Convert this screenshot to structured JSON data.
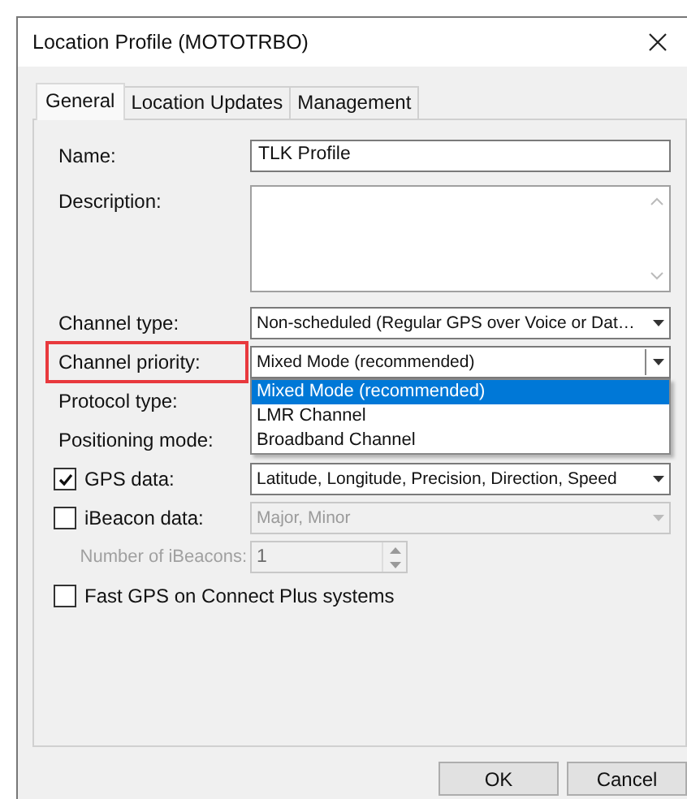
{
  "window": {
    "title": "Location Profile (MOTOTRBO)"
  },
  "tabs": [
    {
      "label": "General",
      "selected": true
    },
    {
      "label": "Location Updates",
      "selected": false
    },
    {
      "label": "Management",
      "selected": false
    }
  ],
  "fields": [
    {
      "kind": "text",
      "label": "Name:",
      "value": "TLK Profile",
      "highlighted": false
    },
    {
      "kind": "textarea",
      "label": "Description:",
      "highlighted": false
    },
    {
      "kind": "select",
      "label": "Channel type:",
      "value": "Non-scheduled (Regular GPS over Voice or Dat…",
      "highlighted": false,
      "expanded": false
    },
    {
      "kind": "select",
      "label": "Channel priority:",
      "value": "Mixed Mode (recommended)",
      "highlighted": true,
      "expanded": true,
      "options": [
        {
          "label": "Mixed Mode (recommended)",
          "selected": true
        },
        {
          "label": "LMR Channel",
          "selected": false
        },
        {
          "label": "Broadband Channel",
          "selected": false
        }
      ]
    },
    {
      "kind": "label",
      "label": "Protocol type:",
      "highlighted": false
    },
    {
      "kind": "label",
      "label": "Positioning mode:",
      "highlighted": false
    },
    {
      "kind": "checkbox-select",
      "label": "GPS data:",
      "checked": true,
      "disabled": false,
      "value": "Latitude, Longitude, Precision, Direction, Speed",
      "highlighted": false
    },
    {
      "kind": "checkbox-select",
      "label": "iBeacon data:",
      "checked": false,
      "disabled": true,
      "value": "Major, Minor",
      "highlighted": false
    },
    {
      "kind": "spinner",
      "label": "Number of iBeacons:",
      "value": "1",
      "disabled": true,
      "highlighted": false
    },
    {
      "kind": "checkbox",
      "label": "Fast GPS on Connect Plus systems",
      "checked": false,
      "highlighted": false
    }
  ],
  "buttons": [
    {
      "label": "OK"
    },
    {
      "label": "Cancel"
    }
  ]
}
